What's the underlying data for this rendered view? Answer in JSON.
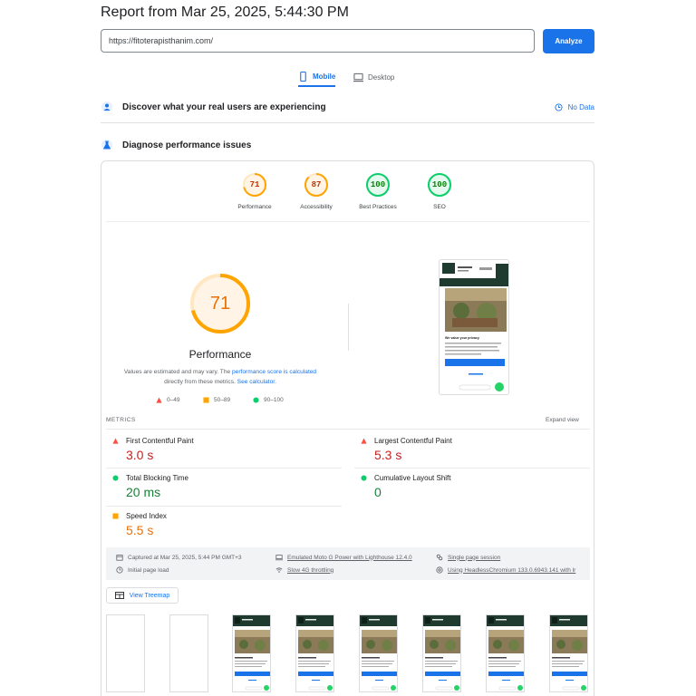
{
  "report": {
    "title": "Report from Mar 25, 2025, 5:44:30 PM"
  },
  "search": {
    "url": "https://fitoterapisthanim.com/",
    "analyze_label": "Analyze"
  },
  "tabs": {
    "mobile": "Mobile",
    "desktop": "Desktop"
  },
  "field_data": {
    "title": "Discover what your real users are experiencing",
    "nodata": "No Data"
  },
  "diagnose": {
    "title": "Diagnose performance issues"
  },
  "scores": [
    {
      "label": "Performance",
      "value": "71",
      "color": "#e8710a"
    },
    {
      "label": "Accessibility",
      "value": "87",
      "color": "#e8710a"
    },
    {
      "label": "Best Practices",
      "value": "100",
      "color": "#0cce6b"
    },
    {
      "label": "SEO",
      "value": "100",
      "color": "#0cce6b"
    }
  ],
  "main_gauge": {
    "value": "71",
    "fraction": 0.71,
    "title": "Performance"
  },
  "perf_desc": {
    "part1": "Values are estimated and may vary. The ",
    "link1": "performance score is calculated",
    "part2": " directly from these metrics. ",
    "link2": "See calculator."
  },
  "legend": {
    "bad": "0–49",
    "avg": "50–89",
    "good": "90–100"
  },
  "metrics": {
    "label": "METRICS",
    "expand": "Expand view",
    "fcp": {
      "name": "First Contentful Paint",
      "value": "3.0 s"
    },
    "lcp": {
      "name": "Largest Contentful Paint",
      "value": "5.3 s"
    },
    "tbt": {
      "name": "Total Blocking Time",
      "value": "20 ms"
    },
    "cls": {
      "name": "Cumulative Layout Shift",
      "value": "0"
    },
    "si": {
      "name": "Speed Index",
      "value": "5.5 s"
    }
  },
  "env": {
    "captured": "Captured at Mar 25, 2025, 5:44 PM GMT+3",
    "device": "Emulated Moto G Power with Lighthouse 12.4.0",
    "session": "Single page session",
    "load": "Initial page load",
    "throttle": "Slow 4G throttling",
    "browser": "Using HeadlessChromium 133.0.6943.141 with lr"
  },
  "treemap": {
    "label": "View Treemap"
  },
  "colors": {
    "accent": "#1a73e8",
    "fail": "#ff4e42",
    "average": "#ffa400",
    "pass": "#0cce6b"
  },
  "screenshot": {
    "privacy_title": "We value your privacy"
  }
}
